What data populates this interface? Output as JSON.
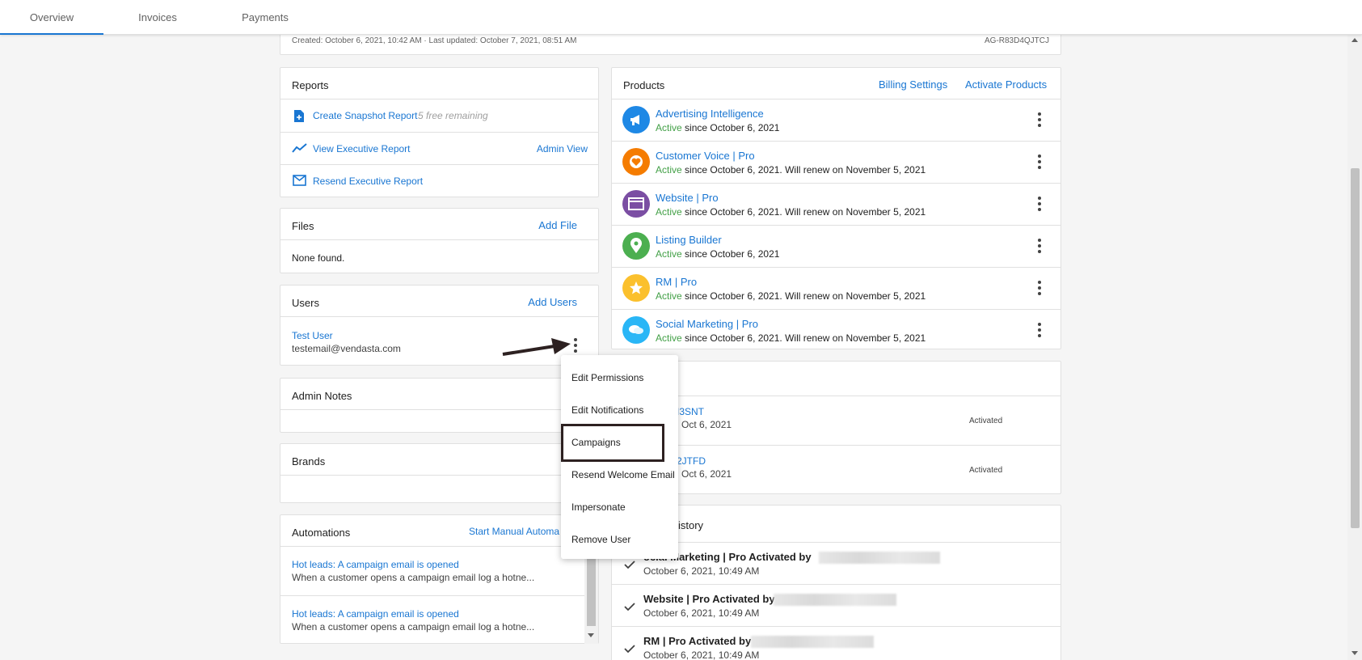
{
  "tabs": [
    {
      "label": "Overview",
      "active": true
    },
    {
      "label": "Invoices",
      "active": false
    },
    {
      "label": "Payments",
      "active": false
    }
  ],
  "meta": {
    "created": "Created: October 6, 2021, 10:42 AM · Last updated: October 7, 2021, 08:51 AM",
    "account_id": "AG-R83D4QJTCJ"
  },
  "reports": {
    "title": "Reports",
    "create_snapshot": "Create Snapshot Report",
    "free_remaining": "5 free remaining",
    "view_executive": "View Executive Report",
    "admin_view": "Admin View",
    "resend_executive": "Resend Executive Report"
  },
  "files": {
    "title": "Files",
    "add_file": "Add File",
    "empty": "None found."
  },
  "users": {
    "title": "Users",
    "add_users": "Add Users",
    "user_name": "Test User",
    "user_email": "testemail@vendasta.com"
  },
  "admin_notes": {
    "title": "Admin Notes"
  },
  "brands": {
    "title": "Brands"
  },
  "automations": {
    "title": "Automations",
    "start_manual": "Start Manual Automa",
    "items": [
      {
        "title": "Hot leads: A campaign email is opened",
        "desc": "When a customer opens a campaign email log a hotne..."
      },
      {
        "title": "Hot leads: A campaign email is opened",
        "desc": "When a customer opens a campaign email log a hotne..."
      }
    ]
  },
  "products": {
    "title": "Products",
    "billing_settings": "Billing Settings",
    "activate_products": "Activate Products",
    "active_label": "Active",
    "items": [
      {
        "name": "Advertising Intelligence",
        "status": " since October 6, 2021",
        "icon": "megaphone-icon",
        "color": "#1e88e5"
      },
      {
        "name": "Customer Voice | Pro",
        "status": " since October 6, 2021. Will renew on November 5, 2021",
        "icon": "heart-icon",
        "color": "#f57c00"
      },
      {
        "name": "Website | Pro",
        "status": " since October 6, 2021. Will renew on November 5, 2021",
        "icon": "browser-icon",
        "color": "#7b4ea3"
      },
      {
        "name": "Listing Builder",
        "status": " since October 6, 2021",
        "icon": "location-pin-icon",
        "color": "#4caf50"
      },
      {
        "name": "RM | Pro",
        "status": " since October 6, 2021. Will renew on November 5, 2021",
        "icon": "star-icon",
        "color": "#fbc02d"
      },
      {
        "name": "Social Marketing | Pro",
        "status": " since October 6, 2021. Will renew on November 5, 2021",
        "icon": "chat-bubbles-icon",
        "color": "#29b6f6"
      }
    ]
  },
  "activations": {
    "items": [
      {
        "code": "I3SNT",
        "date": "Oct 6, 2021",
        "status": "Activated"
      },
      {
        "code": "2JTFD",
        "date": "Oct 6, 2021",
        "status": "Activated"
      }
    ]
  },
  "history": {
    "title": "istory",
    "items": [
      {
        "text": "ocial Marketing | Pro Activated by",
        "time": "October 6, 2021, 10:49 AM"
      },
      {
        "text": "Website | Pro Activated by",
        "time": "October 6, 2021, 10:49 AM"
      },
      {
        "text": "RM | Pro Activated by",
        "time": "October 6, 2021, 10:49 AM"
      }
    ]
  },
  "user_menu": {
    "items": [
      "Edit Permissions",
      "Edit Notifications",
      "Campaigns",
      "Resend Welcome Email",
      "Impersonate",
      "Remove User"
    ]
  },
  "colors": {
    "link": "#1976d2",
    "active": "#43a047",
    "tab_indicator": "#1976d2"
  }
}
